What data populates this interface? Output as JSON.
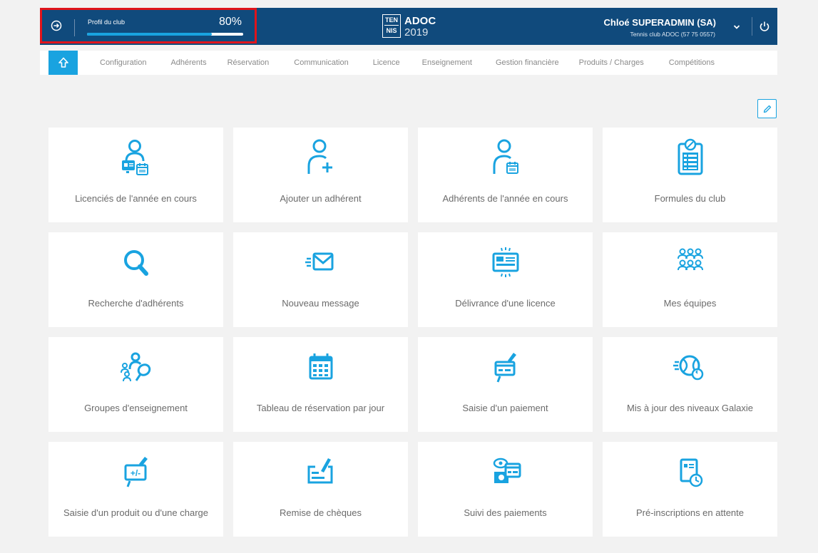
{
  "header": {
    "profile": {
      "label": "Profil du club",
      "percent_text": "80%",
      "progress": 0.8
    },
    "brand": {
      "logo_text": [
        "TEN",
        "NIS"
      ],
      "name": "ADOC",
      "year": "2019"
    },
    "user": {
      "name": "Chloé SUPERADMIN (SA)",
      "club": "Tennis club ADOC (57 75 0557)"
    }
  },
  "nav": {
    "items": [
      "Configuration",
      "Adhérents",
      "Réservation",
      "Communication",
      "Licence",
      "Enseignement",
      "Gestion financière",
      "Produits / Charges",
      "Compétitions"
    ]
  },
  "tiles": [
    {
      "label": "Licenciés de l'année en cours",
      "icon": "user-card-calendar-icon"
    },
    {
      "label": "Ajouter un adhérent",
      "icon": "user-plus-icon"
    },
    {
      "label": "Adhérents de l'année en cours",
      "icon": "user-calendar-icon"
    },
    {
      "label": "Formules du club",
      "icon": "clipboard-list-icon"
    },
    {
      "label": "Recherche d'adhérents",
      "icon": "search-icon"
    },
    {
      "label": "Nouveau message",
      "icon": "envelope-icon"
    },
    {
      "label": "Délivrance d'une licence",
      "icon": "id-card-icon"
    },
    {
      "label": "Mes équipes",
      "icon": "teams-icon"
    },
    {
      "label": "Groupes d'enseignement",
      "icon": "teaching-group-icon"
    },
    {
      "label": "Tableau de réservation par jour",
      "icon": "calendar-grid-icon"
    },
    {
      "label": "Saisie d'un paiement",
      "icon": "payment-entry-icon"
    },
    {
      "label": "Mis à jour des niveaux Galaxie",
      "icon": "tennis-ball-refresh-icon"
    },
    {
      "label": "Saisie d'un produit ou d'une charge",
      "icon": "plus-minus-entry-icon"
    },
    {
      "label": "Remise de chèques",
      "icon": "cheque-icon"
    },
    {
      "label": "Suivi des paiements",
      "icon": "payments-tracking-icon"
    },
    {
      "label": "Pré-inscriptions en attente",
      "icon": "pending-registration-icon"
    }
  ],
  "colors": {
    "header_bg": "#104a7c",
    "accent": "#19a3e0",
    "highlight_border": "#e0141b",
    "page_bg": "#f2f2f2"
  }
}
